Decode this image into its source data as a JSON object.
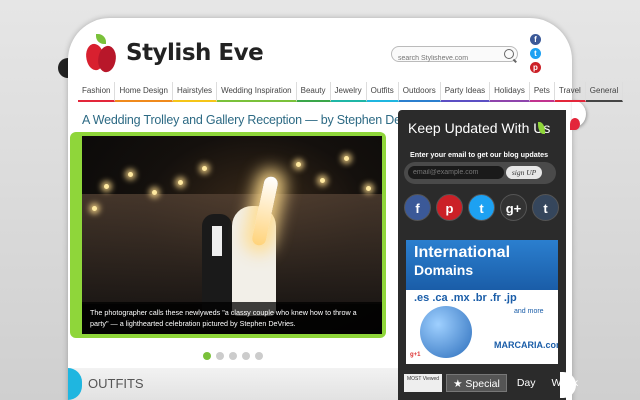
{
  "site": {
    "logo_text": "Stylish Eve",
    "search_placeholder": "search Stylisheve.com"
  },
  "side_social": [
    {
      "icon": "facebook-icon",
      "glyph": "f",
      "color": "#3b5998"
    },
    {
      "icon": "twitter-icon",
      "glyph": "t",
      "color": "#1da1f2"
    },
    {
      "icon": "pinterest-icon",
      "glyph": "p",
      "color": "#cb2027"
    }
  ],
  "nav": [
    {
      "label": "Fashion",
      "color": "#e3263a"
    },
    {
      "label": "Home Design",
      "color": "#f08a1c"
    },
    {
      "label": "Hairstyles",
      "color": "#f5c518"
    },
    {
      "label": "Wedding Inspiration",
      "color": "#7ac13a"
    },
    {
      "label": "Beauty",
      "color": "#3aa64a"
    },
    {
      "label": "Jewelry",
      "color": "#1fb6a6"
    },
    {
      "label": "Outfits",
      "color": "#1fb6e0"
    },
    {
      "label": "Outdoors",
      "color": "#2b7fcf"
    },
    {
      "label": "Party Ideas",
      "color": "#5b4fc4"
    },
    {
      "label": "Holidays",
      "color": "#8e44ad"
    },
    {
      "label": "Pets",
      "color": "#c2338f"
    },
    {
      "label": "Travel",
      "color": "#e3263a"
    },
    {
      "label": "General",
      "color": "#444444"
    }
  ],
  "featured": {
    "headline": "A Wedding Trolley and Gallery Reception — by Stephen DeVries",
    "caption": "The photographer calls these newlyweds \"a classy couple who knew how to throw a party\" — a lighthearted celebration pictured by Stephen DeVries.",
    "slide_count": 5,
    "active_slide": 0
  },
  "section": {
    "title": "OUTFITS"
  },
  "sidebar": {
    "title": "Keep Updated With Us",
    "subtitle": "Enter your email to get our blog updates",
    "email_placeholder": "email@example.com",
    "signup_label": "sign UP",
    "social": [
      {
        "icon": "facebook-icon",
        "glyph": "f",
        "color": "#3b5998"
      },
      {
        "icon": "pinterest-icon",
        "glyph": "p",
        "color": "#cb2027"
      },
      {
        "icon": "twitter-icon",
        "glyph": "t",
        "color": "#1da1f2"
      },
      {
        "icon": "google-plus-icon",
        "glyph": "g+",
        "color": "#333333"
      },
      {
        "icon": "tumblr-icon",
        "glyph": "t",
        "color": "#35465c"
      }
    ]
  },
  "ad": {
    "line1": "International",
    "line2": "Domains",
    "tlds": ".es .ca .mx .br .fr .jp",
    "more": "and more",
    "brand": "MARCARIA.com",
    "badge": "g+1"
  },
  "tabs": {
    "most_viewed": "MOST Viewed",
    "special": "★ Special",
    "day": "Day",
    "week": "Week"
  }
}
